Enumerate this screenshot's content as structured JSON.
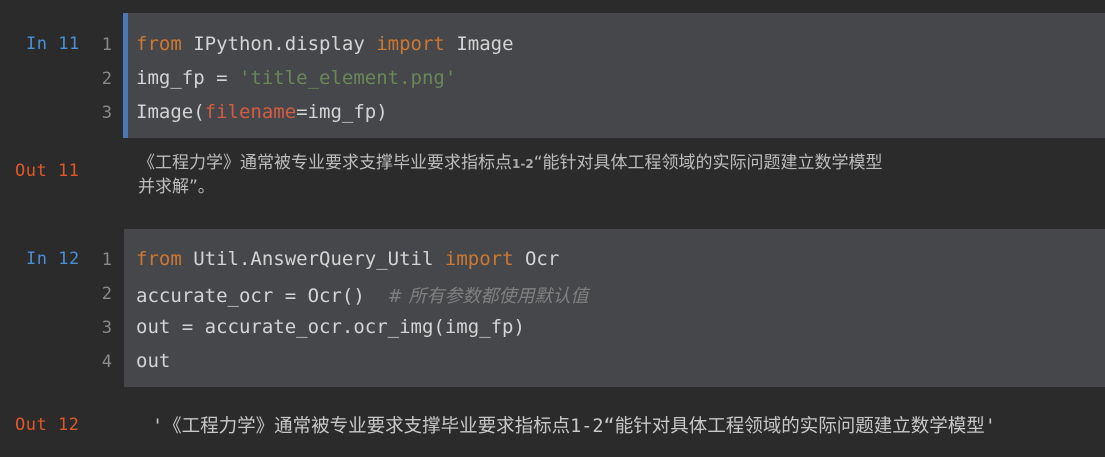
{
  "cells": [
    {
      "in_prompt": "In 11",
      "out_prompt": "Out 11",
      "line_numbers": [
        "1",
        "2",
        "3"
      ],
      "code": [
        {
          "kw1": "from",
          "text1": " IPython.display ",
          "kw2": "import",
          "text2": " Image"
        },
        {
          "text": "img_fp = ",
          "str": "'title_element.png'"
        },
        {
          "pre": "Image(",
          "param": "filename",
          "post": "=img_fp)"
        }
      ],
      "output_image_text": {
        "part1": "《工程力学》通常被专业要求支撑毕业要求指标点",
        "small": "1-2",
        "part2": "“能针对具体工程领域的实际问题建立数学模型",
        "line2": "并求解”。"
      }
    },
    {
      "in_prompt": "In 12",
      "out_prompt": "Out 12",
      "line_numbers": [
        "1",
        "2",
        "3",
        "4"
      ],
      "code": [
        {
          "kw1": "from",
          "text1": " Util.AnswerQuery_Util ",
          "kw2": "import",
          "text2": " Ocr"
        },
        {
          "text": "accurate_ocr = Ocr()  ",
          "comment": "# 所有参数都使用默认值"
        },
        {
          "text": "out = accurate_ocr.ocr_img(img_fp)"
        },
        {
          "text": "out"
        }
      ],
      "output_text": "'《工程力学》通常被专业要求支撑毕业要求指标点1-2“能针对具体工程领域的实际问题建立数学模型'"
    }
  ],
  "colors": {
    "background": "#2b2b2b",
    "cell_background": "#45474a",
    "active_cell_border": "#4a78b4",
    "in_prompt": "#4a8fd8",
    "out_prompt": "#e0582a",
    "keyword": "#cc7832",
    "string": "#6a8759",
    "param": "#d35c40",
    "comment": "#808080"
  }
}
